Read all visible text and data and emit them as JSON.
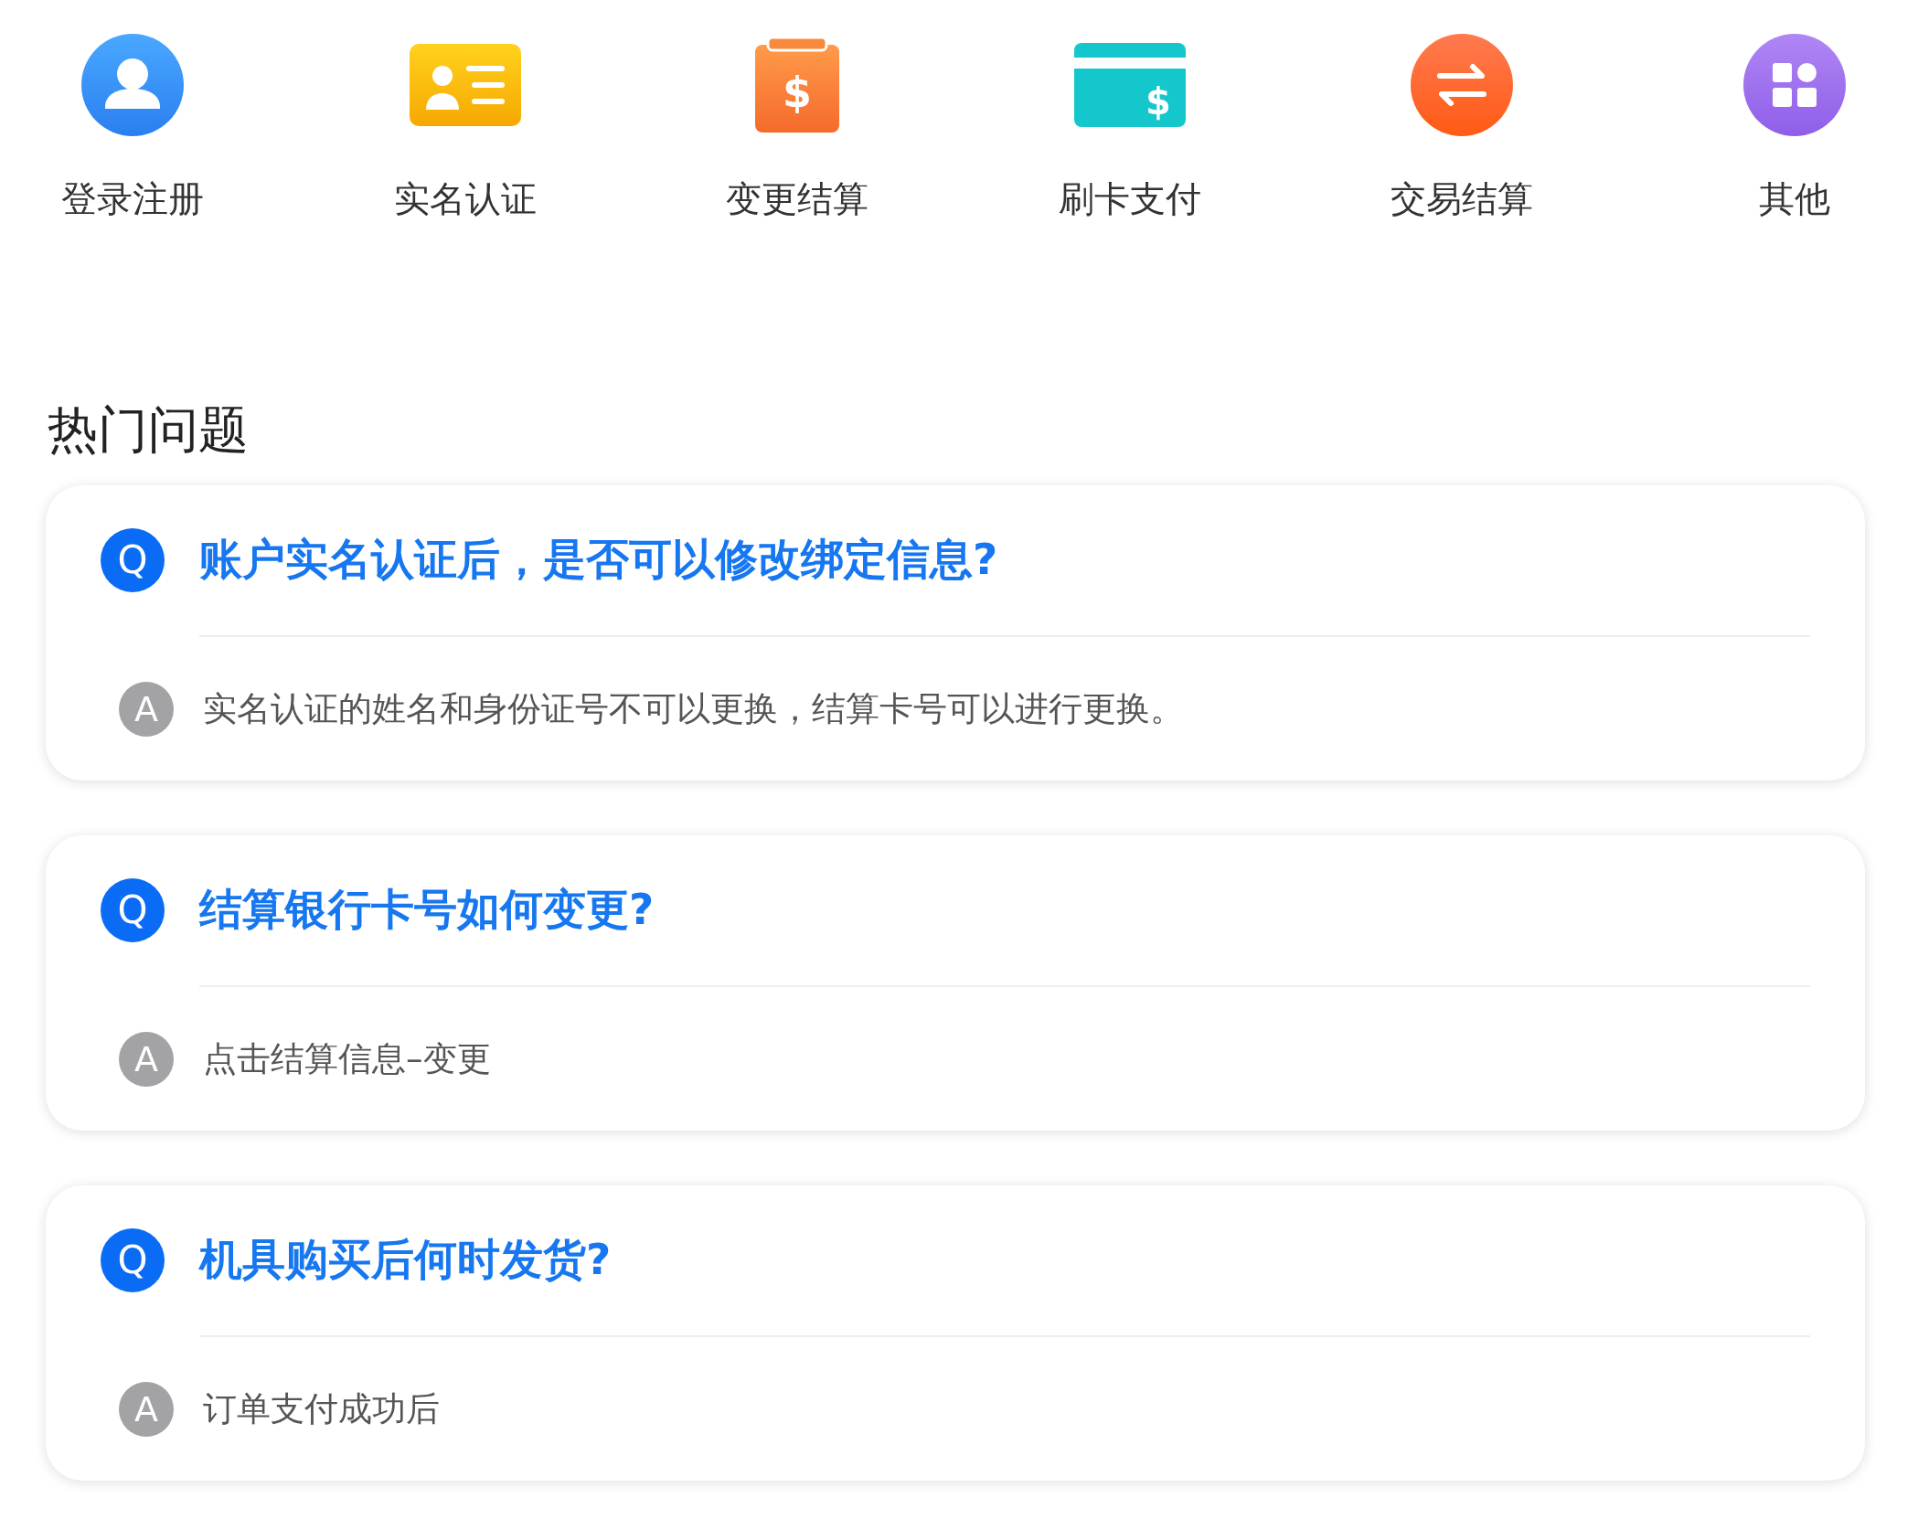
{
  "shortcuts": [
    {
      "label": "登录注册"
    },
    {
      "label": "实名认证"
    },
    {
      "label": "变更结算",
      "glyph": "$"
    },
    {
      "label": "刷卡支付",
      "glyph": "$"
    },
    {
      "label": "交易结算"
    },
    {
      "label": "其他"
    }
  ],
  "hot_questions": {
    "title": "热门问题",
    "items": [
      {
        "q_badge": "Q",
        "question": "账户实名认证后，是否可以修改绑定信息?",
        "a_badge": "A",
        "answer": "实名认证的姓名和身份证号不可以更换，结算卡号可以进行更换。"
      },
      {
        "q_badge": "Q",
        "question": "结算银行卡号如何变更?",
        "a_badge": "A",
        "answer": "点击结算信息–变更"
      },
      {
        "q_badge": "Q",
        "question": "机具购买后何时发货?",
        "a_badge": "A",
        "answer": "订单支付成功后"
      }
    ]
  }
}
